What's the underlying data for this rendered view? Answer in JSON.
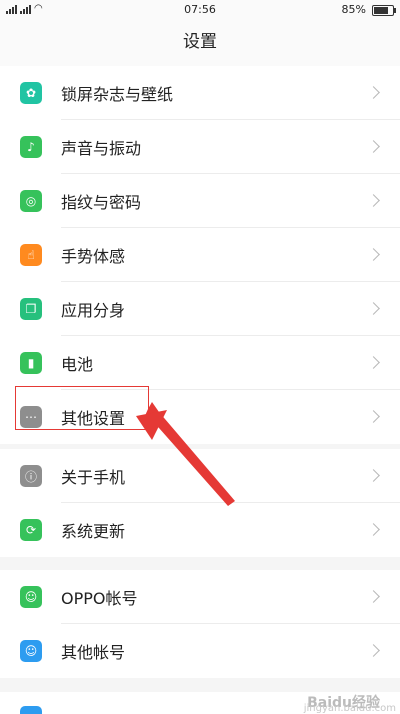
{
  "status": {
    "time": "07:56",
    "battery": "85%",
    "battery_level": 0.85
  },
  "header": {
    "title": "设置"
  },
  "groups": [
    {
      "items": [
        {
          "label": "锁屏杂志与壁纸",
          "icon": "flower-icon",
          "color": "#21c4a3"
        },
        {
          "label": "声音与振动",
          "icon": "speaker-icon",
          "color": "#36c25b"
        },
        {
          "label": "指纹与密码",
          "icon": "fingerprint-icon",
          "color": "#36c25b"
        },
        {
          "label": "手势体感",
          "icon": "hand-gesture-icon",
          "color": "#ff8a1f"
        },
        {
          "label": "应用分身",
          "icon": "app-clone-icon",
          "color": "#26c07d"
        },
        {
          "label": "电池",
          "icon": "battery-icon",
          "color": "#36c25b"
        },
        {
          "label": "其他设置",
          "icon": "more-dots-icon",
          "color": "#8e8e8e"
        }
      ]
    },
    {
      "items": [
        {
          "label": "关于手机",
          "icon": "info-icon",
          "color": "#8e8e8e"
        },
        {
          "label": "系统更新",
          "icon": "update-icon",
          "color": "#36c25b"
        }
      ]
    },
    {
      "items": [
        {
          "label": "OPPO帐号",
          "icon": "account-icon",
          "color": "#36c25b"
        },
        {
          "label": "其他帐号",
          "icon": "user-icon",
          "color": "#2d9cf0"
        }
      ]
    }
  ],
  "watermark": {
    "text": "Baidu经验",
    "sub": "jingyan.baidu.com"
  }
}
